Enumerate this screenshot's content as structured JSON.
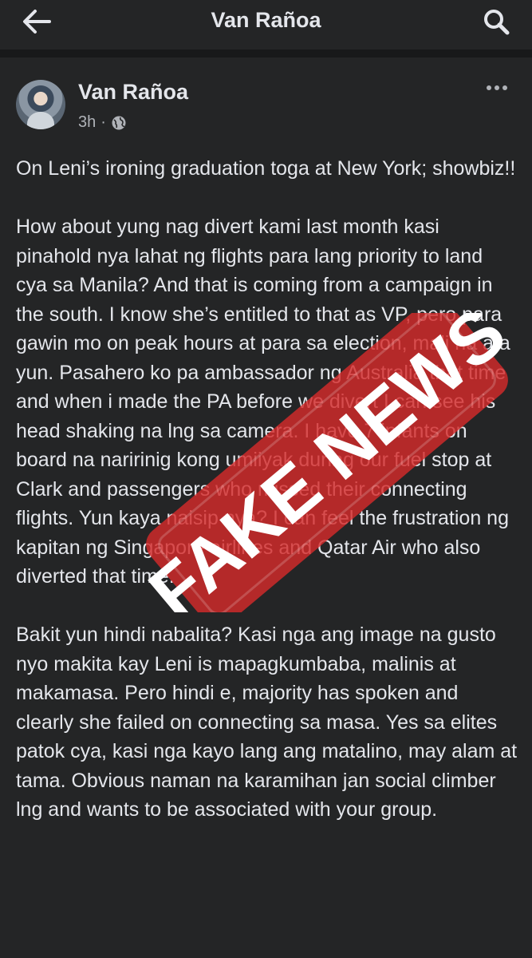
{
  "header": {
    "title": "Van Rañoa"
  },
  "post": {
    "author": "Van Rañoa",
    "time": "3h",
    "separator": "·",
    "paragraphs": [
      "On Leni’s ironing graduation toga at New York; showbiz!!",
      "How about yung nag divert kami last month kasi pinahold nya lahat ng flights para lang priority to land cya sa Manila? And that is coming from a campaign in the south. I know she’s entitled to that as VP, pero para gawin mo on peak hours at para sa election, mali na ata yun. Pasahero ko pa ambassador ng Australia that time and when i made the PA before we divert I can see his head shaking na lng sa camera. I have 7 infants on board na naririnig kong umiiyak during our fuel stop at Clark and passengers who missed their connecting flights. Yun kaya naisip nya? I can feel the frustration ng kapitan ng Singapore airlines and Qatar Air who also diverted that time.",
      "Bakit yun hindi nabalita? Kasi nga ang image na gusto nyo makita kay Leni is mapagkumbaba, malinis at makamasa. Pero hindi e, majority has spoken and clearly she failed on connecting sa masa. Yes sa elites patok cya, kasi nga kayo lang ang matalino, may alam at tama. Obvious naman na karamihan jan social climber lng and wants to be associated with your group."
    ]
  },
  "stamp": {
    "text": "FAKE NEWS",
    "color": "#d42b2b"
  },
  "icons": {
    "back": "arrow-left-icon",
    "search": "search-icon",
    "privacy": "globe-icon",
    "more": "more-dots-icon"
  }
}
